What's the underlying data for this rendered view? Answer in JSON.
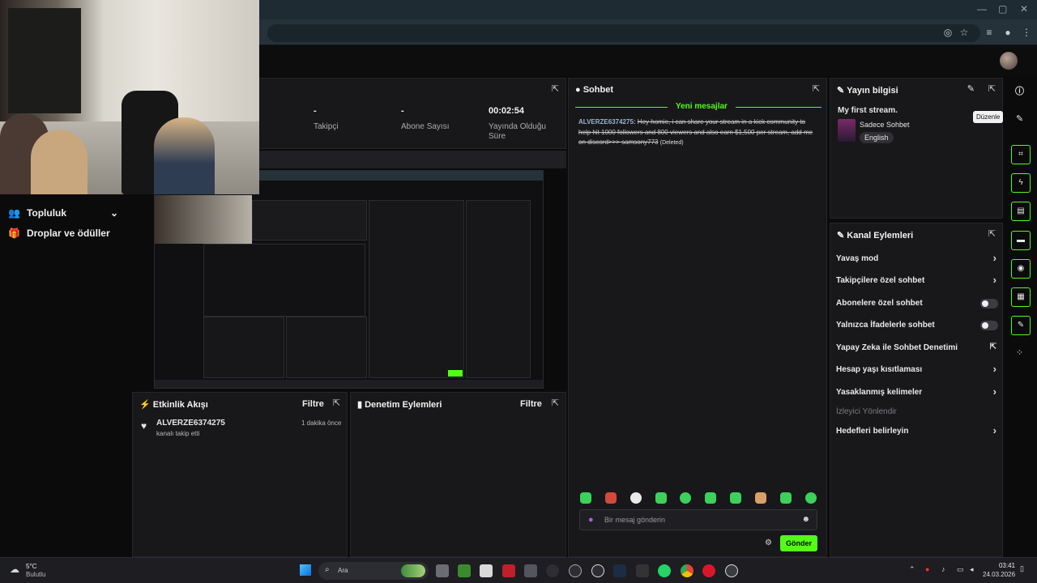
{
  "colors": {
    "accent": "#53fc18",
    "panel": "#18181a",
    "bg": "#0b0b0c",
    "taskbar": "#1d1d22"
  },
  "sidebar": {
    "items": [
      {
        "label": "Topluluk",
        "icon": "people-icon"
      },
      {
        "label": "Droplar ve ödüller",
        "icon": "gift-icon"
      }
    ]
  },
  "stats": {
    "followers": {
      "value": "-",
      "label": "Takipçi"
    },
    "subscribers": {
      "value": "-",
      "label": "Abone Sayısı"
    },
    "uptime": {
      "value": "00:02:54",
      "label": "Yayında Olduğu Süre"
    }
  },
  "activity": {
    "title": "Etkinlik Akışı",
    "filter_label": "Filtre",
    "events": [
      {
        "user": "ALVERZE6374275",
        "action": "kanalı takip etti",
        "time": "1 dakika önce"
      }
    ]
  },
  "moderation": {
    "title": "Denetim Eylemleri",
    "filter_label": "Filtre"
  },
  "chat": {
    "title": "Sohbet",
    "new_messages": "Yeni mesajlar",
    "messages": [
      {
        "user": "ALVERZE6374275:",
        "text": "Hey homie, i can share your stream in a kick community to help hit 1000 followers and 800 viewers and also earn $1,500 per stream, add me on discord>>> samsony773",
        "status": "(Deleted)"
      }
    ],
    "input_placeholder": "Bir mesaj gönderin",
    "send_label": "Gönder"
  },
  "stream_info": {
    "title": "Yayın bilgisi",
    "stream_title": "My first stream.",
    "category": "Sadece Sohbet",
    "language": "English",
    "tooltip": "Düzenle"
  },
  "channel_actions": {
    "title": "Kanal Eylemleri",
    "items": [
      {
        "label": "Yavaş mod",
        "control": "chevron"
      },
      {
        "label": "Takipçilere özel sohbet",
        "control": "chevron"
      },
      {
        "label": "Abonelere özel sohbet",
        "control": "toggle"
      },
      {
        "label": "Yalnızca İfadelerle sohbet",
        "control": "toggle"
      },
      {
        "label": "Yapay Zeka ile Sohbet Denetimi",
        "control": "external"
      },
      {
        "label": "Hesap yaşı kısıtlaması",
        "control": "chevron"
      },
      {
        "label": "Yasaklanmış kelimeler",
        "control": "chevron"
      }
    ],
    "section_label": "İzleyici Yönlendir",
    "extra_item": "Hedefleri belirleyin"
  },
  "taskbar": {
    "weather_temp": "5°C",
    "weather_desc": "Bulutlu",
    "search_label": "Ara",
    "time": "03:41",
    "date": "24.03.2026"
  }
}
